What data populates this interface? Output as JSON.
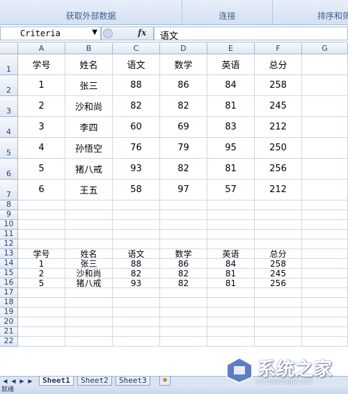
{
  "ribbon": {
    "groups": [
      {
        "label": "获取外部数据"
      },
      {
        "label": "连接"
      },
      {
        "label": "排序和筛"
      }
    ]
  },
  "formula_bar": {
    "name_box": "Criteria",
    "fx_label": "fx",
    "content": "语文"
  },
  "columns": [
    "A",
    "B",
    "C",
    "D",
    "E",
    "F",
    "G"
  ],
  "rows": [
    {
      "n": "1",
      "cells": [
        "学号",
        "姓名",
        "语文",
        "数学",
        "英语",
        "总分"
      ]
    },
    {
      "n": "2",
      "cells": [
        "1",
        "张三",
        "88",
        "86",
        "84",
        "258"
      ]
    },
    {
      "n": "3",
      "cells": [
        "2",
        "沙和尚",
        "82",
        "82",
        "81",
        "245"
      ]
    },
    {
      "n": "4",
      "cells": [
        "3",
        "李四",
        "60",
        "69",
        "83",
        "212"
      ]
    },
    {
      "n": "5",
      "cells": [
        "4",
        "孙悟空",
        "76",
        "79",
        "95",
        "250"
      ]
    },
    {
      "n": "6",
      "cells": [
        "5",
        "猪八戒",
        "93",
        "82",
        "81",
        "256"
      ]
    },
    {
      "n": "7",
      "cells": [
        "6",
        "王五",
        "58",
        "97",
        "57",
        "212"
      ]
    },
    {
      "n": "8",
      "cells": []
    },
    {
      "n": "9",
      "cells": []
    },
    {
      "n": "10",
      "cells": []
    },
    {
      "n": "11",
      "cells": []
    },
    {
      "n": "12",
      "cells": []
    },
    {
      "n": "13",
      "cells": [
        "学号",
        "姓名",
        "语文",
        "数学",
        "英语",
        "总分"
      ]
    },
    {
      "n": "14",
      "cells": [
        "1",
        "张三",
        "88",
        "86",
        "84",
        "258"
      ]
    },
    {
      "n": "15",
      "cells": [
        "2",
        "沙和尚",
        "82",
        "82",
        "81",
        "245"
      ]
    },
    {
      "n": "16",
      "cells": [
        "5",
        "猪八戒",
        "93",
        "82",
        "81",
        "256"
      ]
    },
    {
      "n": "17",
      "cells": []
    },
    {
      "n": "18",
      "cells": []
    },
    {
      "n": "19",
      "cells": []
    },
    {
      "n": "20",
      "cells": []
    },
    {
      "n": "21",
      "cells": []
    },
    {
      "n": "22",
      "cells": []
    }
  ],
  "sheet_tabs": [
    "Sheet1",
    "Sheet2",
    "Sheet3"
  ],
  "active_tab": "Sheet1",
  "status": "就绪",
  "watermark": {
    "title": "系统之家",
    "url": "XITONGZHIJIA.NET"
  },
  "colors": {
    "header_text": "#27416b",
    "grid_line": "#d0d7e5",
    "ribbon": "#d5e1f2"
  }
}
